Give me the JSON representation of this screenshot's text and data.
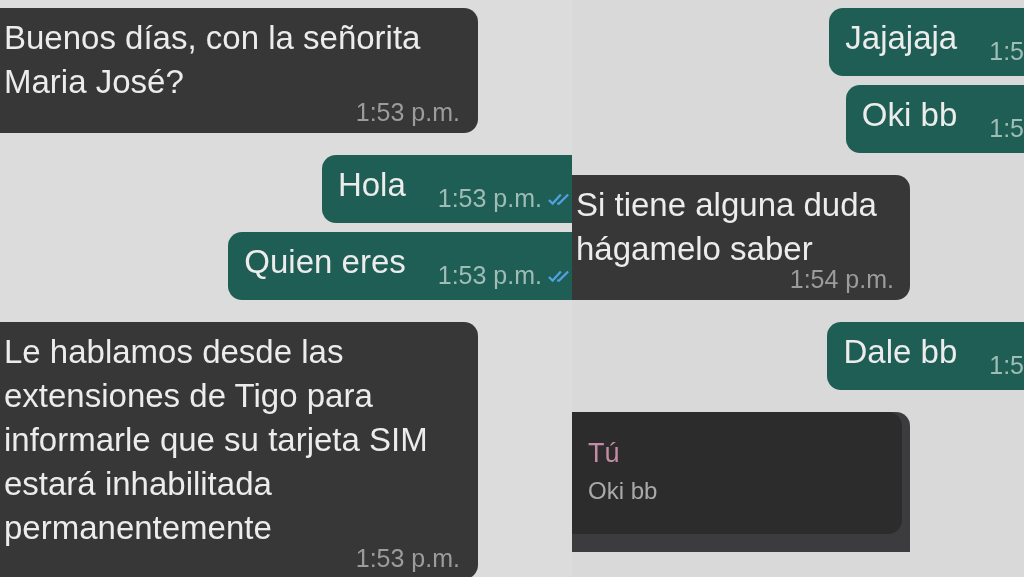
{
  "panels": [
    {
      "messages": [
        {
          "outgoing": false,
          "kind": "text",
          "text": "Buenos días, con la señorita Maria José?",
          "time": "1:53 p.m."
        },
        {
          "outgoing": true,
          "kind": "text",
          "text": "Hola",
          "time": "1:53 p.m.",
          "read": true
        },
        {
          "outgoing": true,
          "kind": "text",
          "text": "Quien eres",
          "time": "1:53 p.m.",
          "read": true
        },
        {
          "outgoing": false,
          "kind": "text",
          "text": "Le hablamos desde las extensiones de Tigo para informarle que su tarjeta SIM estará inhabilitada permanentemente",
          "time": "1:53 p.m."
        }
      ]
    },
    {
      "messages": [
        {
          "outgoing": true,
          "kind": "text",
          "text": "Jajajaja",
          "time": "1:5"
        },
        {
          "outgoing": true,
          "kind": "text",
          "text": "Oki bb",
          "time": "1:5"
        },
        {
          "outgoing": false,
          "kind": "text",
          "text": "Si tiene alguna duda hágamelo saber",
          "time": "1:54 p.m."
        },
        {
          "outgoing": true,
          "kind": "text",
          "text": "Dale bb",
          "time": "1:5"
        },
        {
          "outgoing": false,
          "kind": "reply",
          "quote": {
            "author": "Tú",
            "text": "Oki bb"
          }
        }
      ]
    }
  ]
}
